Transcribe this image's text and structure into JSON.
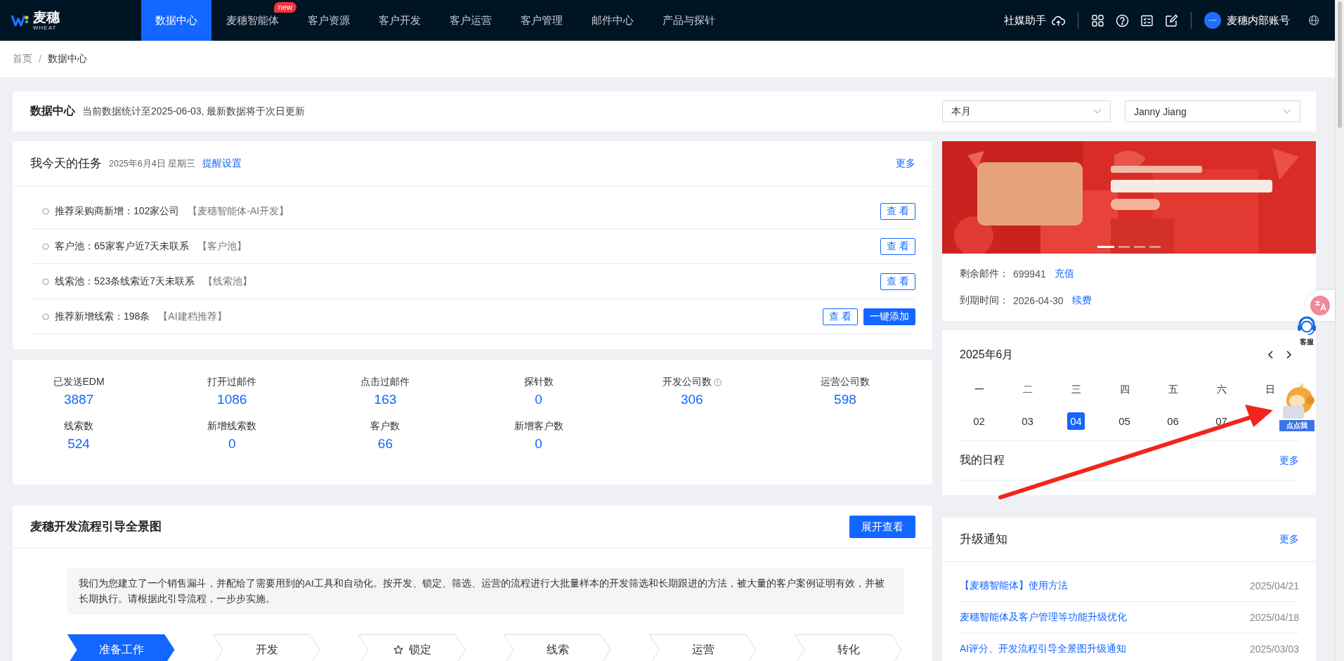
{
  "nav": {
    "logo": {
      "name": "麦穗",
      "sub": "WHEAT"
    },
    "tabs": [
      {
        "label": "数据中心",
        "selected": true
      },
      {
        "label": "麦穗智能体",
        "selected": false,
        "badge": "new"
      },
      {
        "label": "客户资源",
        "selected": false
      },
      {
        "label": "客户开发",
        "selected": false
      },
      {
        "label": "客户运营",
        "selected": false
      },
      {
        "label": "客户管理",
        "selected": false
      },
      {
        "label": "邮件中心",
        "selected": false
      },
      {
        "label": "产品与探针",
        "selected": false
      }
    ],
    "assistant": "社媒助手",
    "account": "麦穗内部账号"
  },
  "breadcrumb": [
    "首页",
    "数据中心"
  ],
  "breadcrumb_separator": "/",
  "header": {
    "title": "数据中心",
    "subtitle": "当前数据统计至2025-06-03, 最新数据将于次日更新",
    "filters": [
      {
        "value": "本月"
      },
      {
        "value": "Janny Jiang"
      }
    ]
  },
  "tasks": {
    "title": "我今天的任务",
    "date": "2025年6月4日 星期三",
    "link": "提醒设置",
    "more": "更多",
    "items": [
      {
        "text": "推荐采购商新增：102家公司",
        "tag": "【麦穗智能体-AI开发】",
        "actions": [
          {
            "label": "查 看",
            "kind": "outline"
          }
        ]
      },
      {
        "text": "客户池：65家客户近7天未联系",
        "tag": "【客户池】",
        "actions": [
          {
            "label": "查 看",
            "kind": "outline"
          }
        ]
      },
      {
        "text": "线索池：523条线索近7天未联系",
        "tag": "【线索池】",
        "actions": [
          {
            "label": "查 看",
            "kind": "outline"
          }
        ]
      },
      {
        "text": "推荐新增线索：198条",
        "tag": "【AI建档推荐】",
        "actions": [
          {
            "label": "查 看",
            "kind": "outline"
          },
          {
            "label": "一键添加",
            "kind": "primary"
          }
        ]
      }
    ]
  },
  "stats": [
    {
      "label": "已发送EDM",
      "value": "3887",
      "info": false
    },
    {
      "label": "打开过邮件",
      "value": "1086",
      "info": false
    },
    {
      "label": "点击过邮件",
      "value": "163",
      "info": false
    },
    {
      "label": "探针数",
      "value": "0",
      "info": false
    },
    {
      "label": "开发公司数",
      "value": "306",
      "info": true
    },
    {
      "label": "运营公司数",
      "value": "598",
      "info": false
    },
    {
      "label": "线索数",
      "value": "524",
      "info": false
    },
    {
      "label": "新增线索数",
      "value": "0",
      "info": false
    },
    {
      "label": "客户数",
      "value": "66",
      "info": false
    },
    {
      "label": "新增客户数",
      "value": "0",
      "info": false
    }
  ],
  "flow": {
    "title": "麦穗开发流程引导全景图",
    "button": "展开查看",
    "description": "我们为您建立了一个销售漏斗，并配给了需要用到的AI工具和自动化。按开发、锁定、筛选、运营的流程进行大批量样本的开发筛选和长期跟进的方法，被大量的客户案例证明有效，并被长期执行。请根据此引导流程，一步步实施。",
    "steps": [
      {
        "label": "准备工作",
        "selected": true,
        "starred": false
      },
      {
        "label": "开发",
        "selected": false,
        "starred": false
      },
      {
        "label": "锁定",
        "selected": false,
        "starred": true
      },
      {
        "label": "线索",
        "selected": false,
        "starred": false
      },
      {
        "label": "运营",
        "selected": false,
        "starred": false
      },
      {
        "label": "转化",
        "selected": false,
        "starred": false
      }
    ]
  },
  "promo": {
    "carousel": [
      {
        "selected": true
      },
      {
        "selected": false
      },
      {
        "selected": false
      },
      {
        "selected": false
      }
    ],
    "lines": [
      {
        "label": "剩余邮件：",
        "value": "699941",
        "link": "充值"
      },
      {
        "label": "到期时间：",
        "value": "2026-04-30",
        "link": "续费"
      }
    ]
  },
  "calendar": {
    "title": "2025年6月",
    "weekdays": [
      "一",
      "二",
      "三",
      "四",
      "五",
      "六",
      "日"
    ],
    "days": [
      {
        "label": "02",
        "selected": false
      },
      {
        "label": "03",
        "selected": false
      },
      {
        "label": "04",
        "selected": true
      },
      {
        "label": "05",
        "selected": false
      },
      {
        "label": "06",
        "selected": false
      },
      {
        "label": "07",
        "selected": false
      }
    ],
    "schedule": "我的日程",
    "more": "更多"
  },
  "notices": {
    "title": "升级通知",
    "more": "更多",
    "items": [
      {
        "title": "【麦穗智能体】使用方法",
        "date": "2025/04/21"
      },
      {
        "title": "麦穗智能体及客户管理等功能升级优化",
        "date": "2025/04/18"
      },
      {
        "title": "AI评分、开发流程引导全景图升级通知",
        "date": "2025/03/03"
      }
    ]
  },
  "widgets": {
    "service": "客服",
    "mascot": "点点我"
  }
}
